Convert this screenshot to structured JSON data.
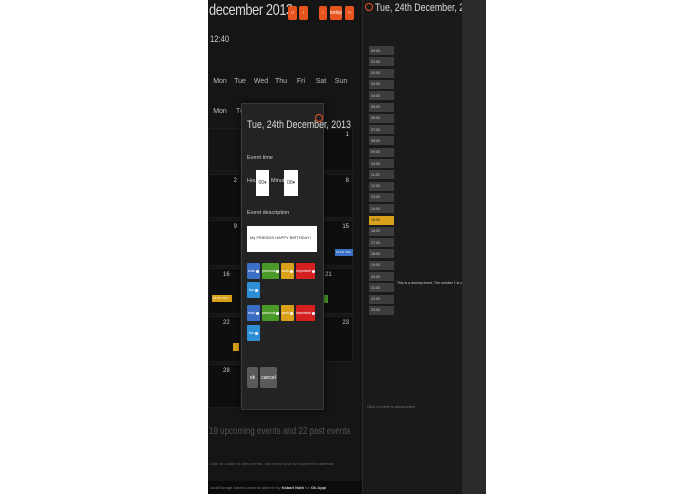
{
  "calendar": {
    "month_title": "december 2013",
    "buttons": [
      "‹‹",
      "‹",
      "›",
      "today",
      "››"
    ],
    "clock": "12:40",
    "weekdays": [
      "Mon",
      "Tue",
      "Wed",
      "Thu",
      "Fri",
      "Sat",
      "Sun"
    ],
    "weekdays_row2": [
      "Mon",
      "Tu"
    ],
    "day_numbers": [
      "1",
      "2",
      "8",
      "9",
      "15",
      "16",
      "21",
      "22",
      "23",
      "28",
      "30"
    ],
    "event_tags": [
      "15:20: This",
      "15:00: This"
    ],
    "summary": "19 upcoming events and 22 past events",
    "hint": "Click on a date to view events. Use arrow keys to browse the calendar.",
    "credit_prefix": "localStorage based personal planner by",
    "credit_author": "Kabari Nath",
    "credit_for": "for",
    "credit_target": "Ok Appi"
  },
  "day_view": {
    "title": "Tue, 24th December, 2013",
    "slots": [
      "00:00",
      "01:00",
      "02:00",
      "03:00",
      "04:00",
      "05:00",
      "06:00",
      "07:00",
      "08:00",
      "09:00",
      "10:00",
      "11:00",
      "12:00",
      "13:00",
      "14:00",
      "15:00",
      "16:00",
      "17:00",
      "18:00",
      "19:00",
      "20:00",
      "21:00",
      "22:00",
      "23:00"
    ],
    "busy_slot": "15:00",
    "slot_note": "This is a dummy event. The number 1 is cool!",
    "add_hint": "Click on a time to add an event"
  },
  "modal": {
    "title": "Tue, 24th December, 2013",
    "event_time_label": "Event time",
    "hour_label": "Hour",
    "hour_value": "00",
    "minute_label": "Minute",
    "minute_value": "00",
    "description_label": "Event description",
    "description_value": "My FRIENDS HAPPY BIRTHDAY!",
    "tags": [
      "todo",
      "personal",
      "work",
      "important",
      "fun"
    ],
    "ok_label": "ok",
    "cancel_label": "cancel"
  },
  "colors": {
    "accent": "#e8541d",
    "todo": "#3a6fc4",
    "personal": "#4a9a2a",
    "work": "#d9a01c",
    "important": "#d42020",
    "fun": "#2f8fd6"
  }
}
